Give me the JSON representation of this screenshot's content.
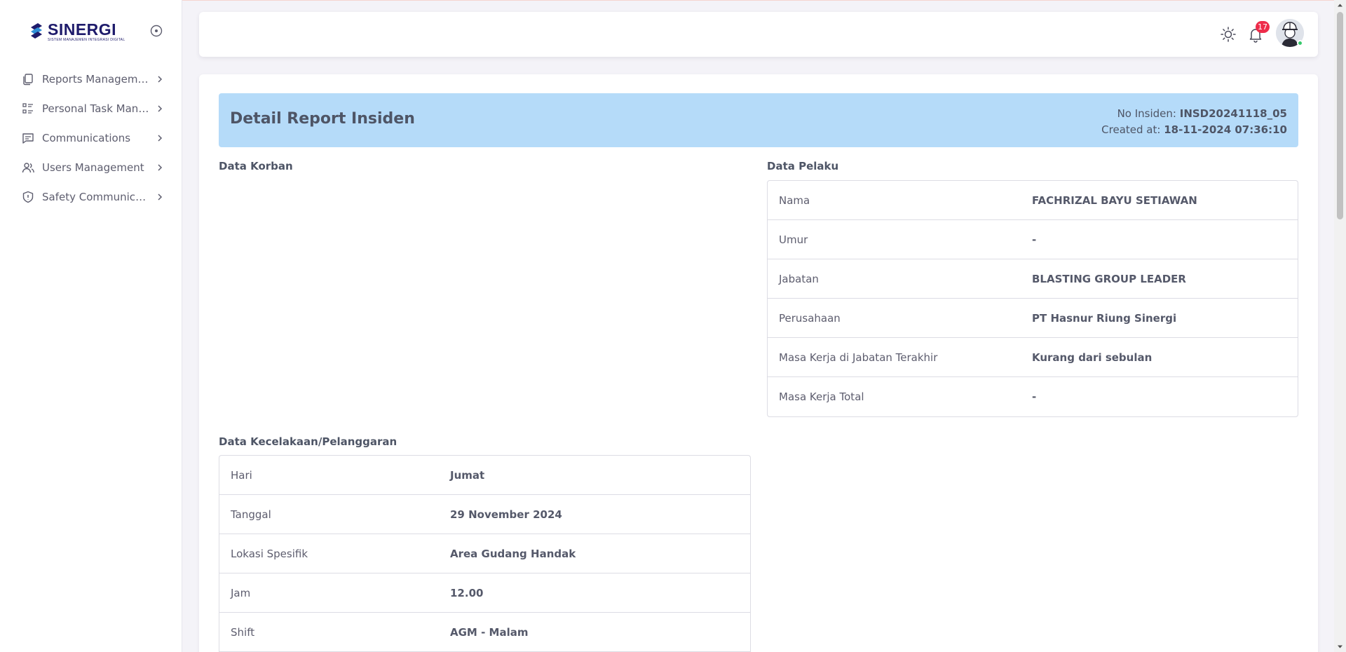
{
  "brand": {
    "name": "SINERGI",
    "tagline": "SISTEM MANAJEMEN INTEGRASI DIGITAL"
  },
  "sidebar": {
    "items": [
      {
        "label": "Reports Management",
        "icon": "files-icon"
      },
      {
        "label": "Personal Task Management",
        "icon": "task-list-icon"
      },
      {
        "label": "Communications",
        "icon": "chat-icon"
      },
      {
        "label": "Users Management",
        "icon": "users-icon"
      },
      {
        "label": "Safety Communications",
        "icon": "shield-icon"
      }
    ]
  },
  "header": {
    "notification_count": "17"
  },
  "report": {
    "title": "Detail Report Insiden",
    "no_label": "No Insiden:",
    "no_value": "INSD20241118_05",
    "created_label": "Created at:",
    "created_value": "18-11-2024 07:36:10"
  },
  "korban": {
    "title": "Data Korban"
  },
  "pelaku": {
    "title": "Data Pelaku",
    "rows": [
      {
        "key": "Nama",
        "value": "FACHRIZAL BAYU SETIAWAN"
      },
      {
        "key": "Umur",
        "value": "-"
      },
      {
        "key": "Jabatan",
        "value": "BLASTING GROUP LEADER"
      },
      {
        "key": "Perusahaan",
        "value": "PT Hasnur Riung Sinergi"
      },
      {
        "key": "Masa Kerja di Jabatan Terakhir",
        "value": "Kurang dari sebulan"
      },
      {
        "key": "Masa Kerja Total",
        "value": "-"
      }
    ]
  },
  "kecelakaan": {
    "title": "Data Kecelakaan/Pelanggaran",
    "rows": [
      {
        "key": "Hari",
        "value": "Jumat"
      },
      {
        "key": "Tanggal",
        "value": "29 November 2024"
      },
      {
        "key": "Lokasi Spesifik",
        "value": "Area Gudang Handak"
      },
      {
        "key": "Jam",
        "value": "12.00"
      },
      {
        "key": "Shift",
        "value": "AGM - Malam"
      }
    ]
  },
  "colors": {
    "banner": "#b5dbf9",
    "badge": "#ee2c4a",
    "brand": "#1e1b6b",
    "online": "#36c96b"
  }
}
